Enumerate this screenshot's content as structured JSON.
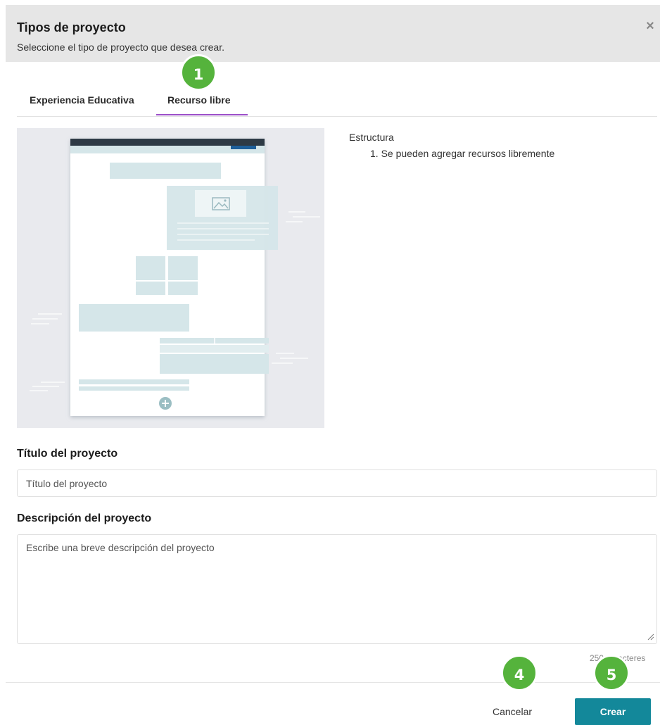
{
  "dialog": {
    "title": "Tipos de proyecto",
    "subtitle": "Seleccione el tipo de proyecto que desea crear.",
    "close_icon": "×"
  },
  "tabs": [
    {
      "label": "Experiencia Educativa",
      "active": false
    },
    {
      "label": "Recurso libre",
      "active": true
    }
  ],
  "badges": [
    "1",
    "4",
    "5"
  ],
  "structure": {
    "heading": "Estructura",
    "items": [
      "1. Se pueden agregar recursos libremente"
    ]
  },
  "form": {
    "title_label": "Título del proyecto",
    "title_placeholder": "Título del proyecto",
    "description_label": "Descripción del proyecto",
    "description_placeholder": "Escribe una breve descripción del proyecto",
    "char_counter": "250 caracteres"
  },
  "buttons": {
    "cancel": "Cancelar",
    "create": "Crear"
  },
  "colors": {
    "accent_tab": "#9c4fc9",
    "primary_button": "#13889a",
    "badge": "#55b33c",
    "header_bg": "#e6e6e6"
  }
}
